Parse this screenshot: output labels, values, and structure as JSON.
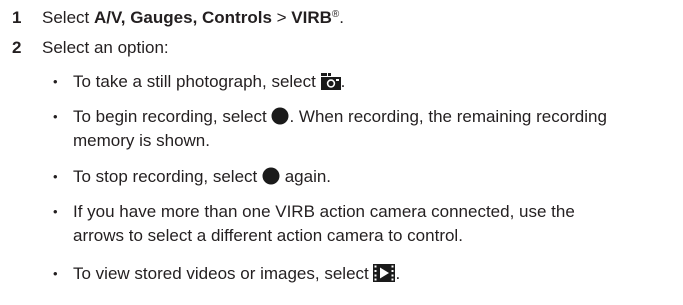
{
  "steps": [
    {
      "number": "1",
      "prefix": "Select ",
      "bold1": "A/V, Gauges, Controls",
      "middle": " > ",
      "bold2": "VIRB",
      "sup": "®",
      "suffix": "."
    },
    {
      "number": "2",
      "text": "Select an option:"
    }
  ],
  "bullets": [
    {
      "marker": "•",
      "before": "To take a still photograph, select ",
      "icon": "camera-icon",
      "after": "."
    },
    {
      "marker": "•",
      "before": "To begin recording, select ",
      "icon": "record-icon",
      "after": ". When recording, the remaining recording",
      "line2": "memory is shown."
    },
    {
      "marker": "•",
      "before": "To stop recording, select ",
      "icon": "record-icon",
      "after": " again."
    },
    {
      "marker": "•",
      "line1": "If you have more than one VIRB action camera connected, use the",
      "line2": "arrows to select a different action camera to control."
    },
    {
      "marker": "•",
      "before": "To view stored videos or images, select ",
      "icon": "play-film-icon",
      "after": "."
    }
  ],
  "colors": {
    "text": "#231f20",
    "icon": "#1a1a1a"
  }
}
